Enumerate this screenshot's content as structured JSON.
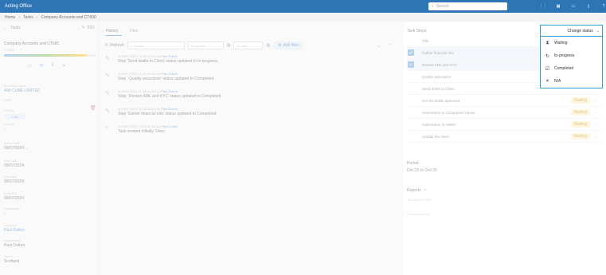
{
  "app": {
    "title": "Acting Office",
    "search_placeholder": "Search"
  },
  "breadcrumb": [
    "Home",
    "Tasks",
    "Company Accounts and CT600"
  ],
  "left": {
    "back_label": "Tasks",
    "edit_count": "539",
    "task_name": "Company Accounts and CT600",
    "task_id": "T-1093",
    "progress": 0.9,
    "fields": [
      {
        "label": "Business name",
        "value": "AIM CUBE LIMITED",
        "link": true
      },
      {
        "label": "CRN",
        "value": "",
        "link": false
      },
      {
        "label": "Priority",
        "value": "Low",
        "pill": true
      },
      {
        "label": "Repeat",
        "value": "-",
        "link": false
      },
      {
        "label": "Action date",
        "value": "09/07/2024",
        "link": false
      },
      {
        "label": "Start date",
        "value": "09/07/2024",
        "link": false
      },
      {
        "label": "Due date",
        "value": "09/07/2024",
        "link": false
      },
      {
        "label": "Deadline",
        "value": "09/07/2024",
        "link": false
      },
      {
        "label": "Description",
        "value": "-",
        "link": false
      },
      {
        "label": "Assignee",
        "value": "Paul Dutton",
        "link": true
      },
      {
        "label": "Accountant",
        "value": "Paul Dutton",
        "link": false
      },
      {
        "label": "Team",
        "value": "Scotland",
        "link": false
      }
    ]
  },
  "middle": {
    "tabs": [
      "History",
      "Files"
    ],
    "refresh_label": "Refresh",
    "search_placeholder": "Search",
    "from_placeholder": "From date",
    "to_placeholder": "To date",
    "add_filter_label": "Add filter",
    "history": [
      {
        "icon": "pencil-icon",
        "meta": "at 09/07/2024 11:26:53 AM by",
        "by": "Paul Dutton",
        "msg": "Step 'Send drafts to Client' status updated to In progress."
      },
      {
        "icon": "pencil-icon",
        "meta": "at 09/07/2024 11:26:49 AM by",
        "by": "Paul Dutton",
        "msg": "Step ' Quality assurance' status updated to Completed."
      },
      {
        "icon": "pencil-icon",
        "meta": "at 09/07/2024 11:26:44 AM by",
        "by": "Paul Dutton",
        "msg": "Step ' Review AML and KYC' status updated to Completed."
      },
      {
        "icon": "pencil-icon",
        "meta": "at 09/07/2024 11:26:38 AM by",
        "by": "Paul Dutton",
        "msg": "Step 'Gather financial info' status updated to Completed."
      },
      {
        "icon": "plus-icon",
        "meta": "at 09/07/2024 10:53:32 AM by",
        "by": "Paul Dutton",
        "msg": "Task created initially. Desc:"
      }
    ]
  },
  "right": {
    "title": "Task Steps",
    "change_status_label": "Change status",
    "column_title": "Title",
    "steps": [
      {
        "name": "Gather financial info",
        "status": "",
        "selected": true
      },
      {
        "name": "Review AML and KYC",
        "status": "",
        "selected": true
      },
      {
        "name": "Quality assurance",
        "status": "",
        "selected": false
      },
      {
        "name": "Send drafts to Client",
        "status": "",
        "selected": false
      },
      {
        "name": "Get the drafts approved",
        "status": "Waiting",
        "selected": false
      },
      {
        "name": "Submission to Companies House",
        "status": "Waiting",
        "selected": false
      },
      {
        "name": "Submission to HMRC",
        "status": "Waiting",
        "selected": false
      },
      {
        "name": "Update the client",
        "status": "Waiting",
        "selected": false
      }
    ],
    "period_label": "Period",
    "period_value": "Dec'25 to Dec'26",
    "reports_label": "Reports",
    "reports": [
      {
        "name": "Tax return CT600",
        "value": "-"
      },
      {
        "name": "Accounts report",
        "value": "-"
      }
    ]
  },
  "status_menu": {
    "options": [
      {
        "icon": "hourglass-icon",
        "label": "Waiting"
      },
      {
        "icon": "in-progress-icon",
        "label": "In-progress"
      },
      {
        "icon": "checkbox-icon",
        "label": "Completed"
      },
      {
        "icon": "na-icon",
        "label": "N/A"
      }
    ]
  }
}
